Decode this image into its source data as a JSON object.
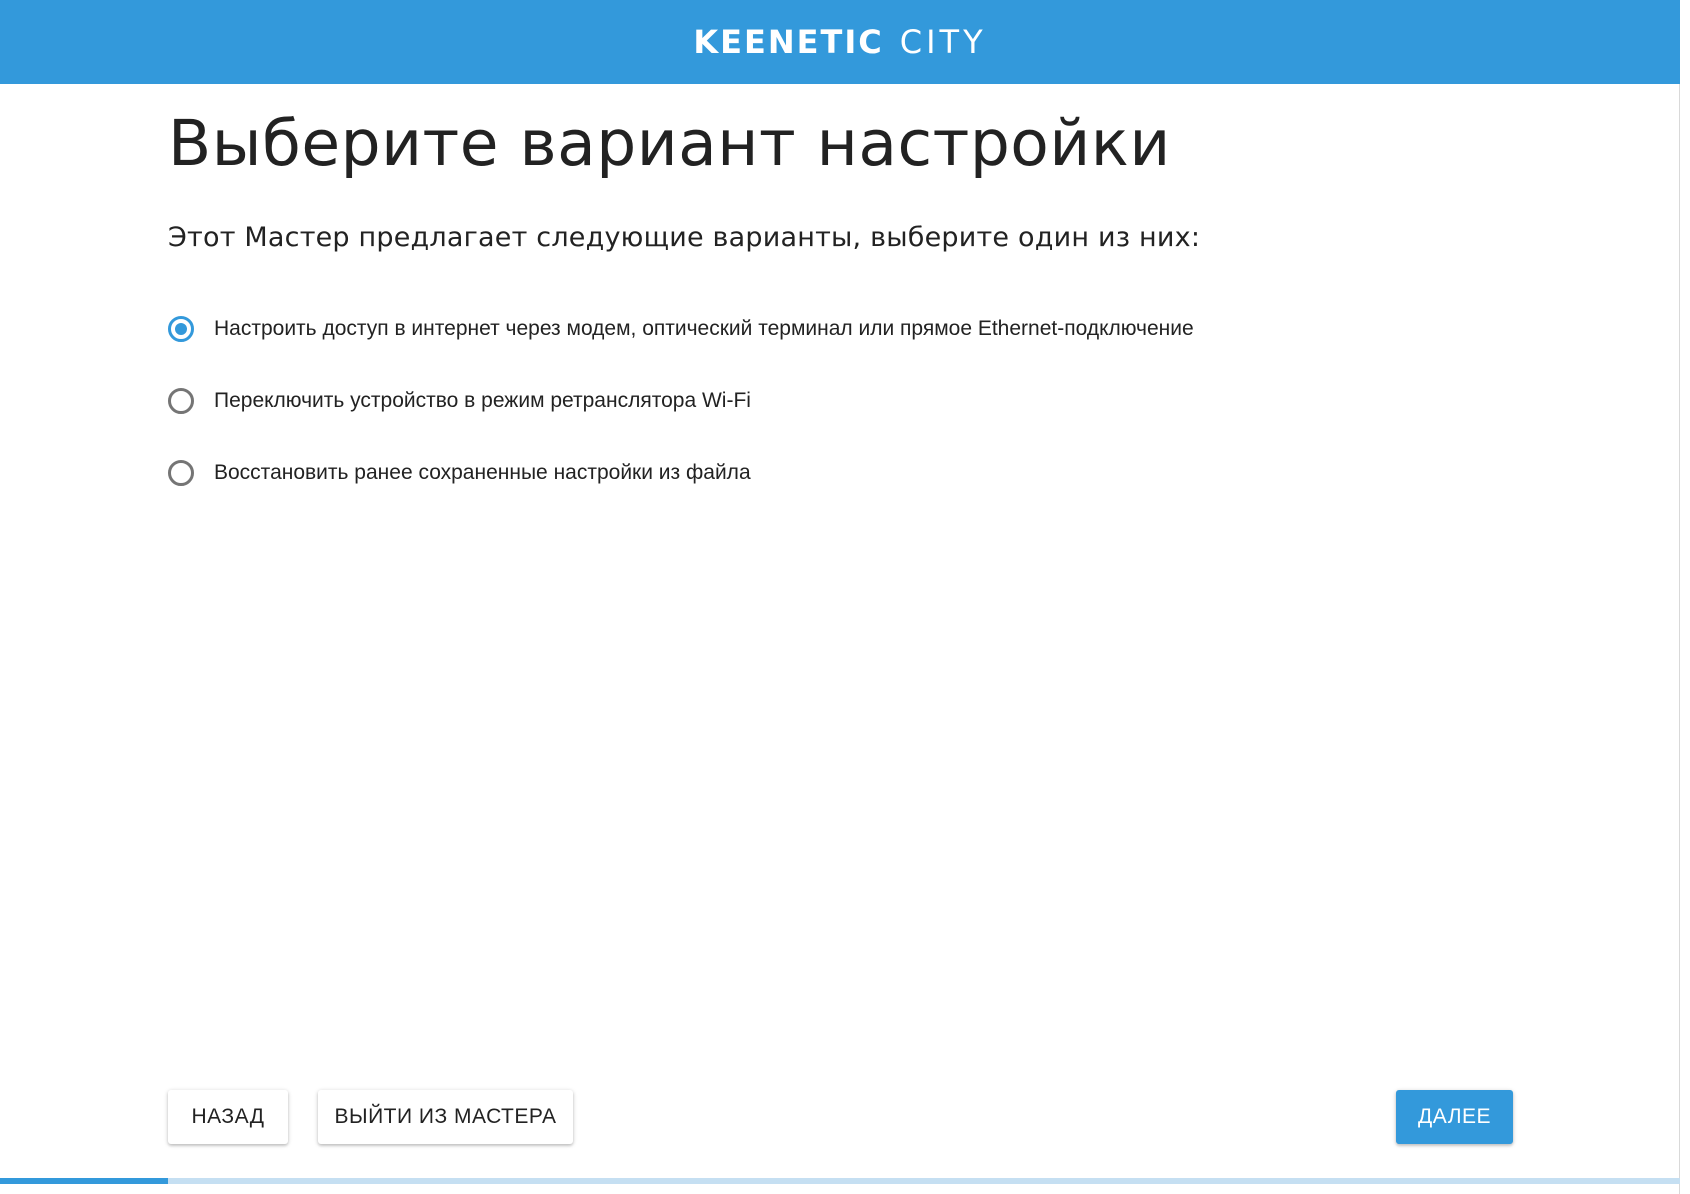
{
  "brand": {
    "name": "KEENETIC",
    "model": "CITY",
    "accent_color": "#3399db"
  },
  "page": {
    "title": "Выберите вариант настройки",
    "subtitle": "Этот Мастер предлагает следующие варианты, выберите один из них:"
  },
  "options": [
    {
      "label": "Настроить доступ в интернет через модем, оптический терминал или прямое Ethernet-подключение",
      "selected": true
    },
    {
      "label": "Переключить устройство в режим ретранслятора Wi-Fi",
      "selected": false
    },
    {
      "label": "Восстановить ранее сохраненные настройки из файла",
      "selected": false
    }
  ],
  "buttons": {
    "back": "НАЗАД",
    "exit": "ВЫЙТИ ИЗ МАСТЕРА",
    "next": "ДАЛЕЕ"
  },
  "progress": {
    "fraction": 0.1
  }
}
